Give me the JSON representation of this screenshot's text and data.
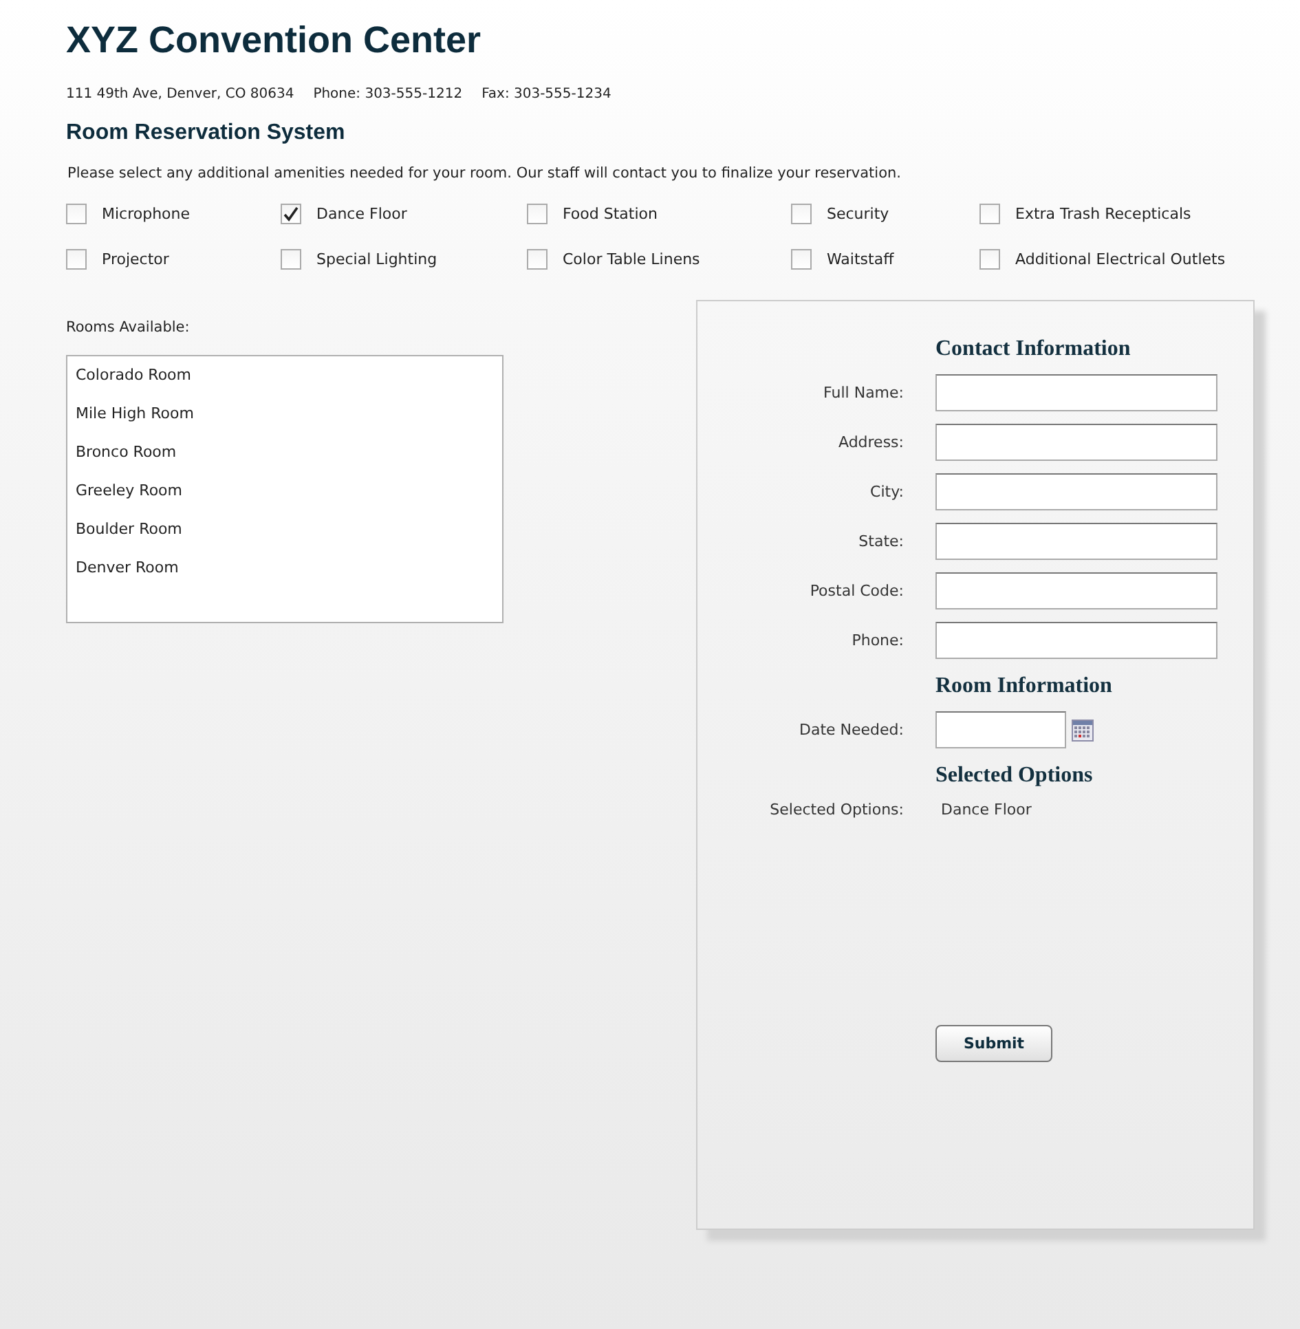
{
  "header": {
    "title": "XYZ Convention Center",
    "address": "111 49th Ave, Denver, CO 80634",
    "phone": "Phone: 303-555-1212",
    "fax": "Fax: 303-555-1234"
  },
  "subtitle": "Room Reservation System",
  "instructions": "Please select any additional amenities needed for your room. Our staff will contact you to finalize your reservation.",
  "amenities": [
    {
      "label": "Microphone",
      "checked": false
    },
    {
      "label": "Dance Floor",
      "checked": true
    },
    {
      "label": "Food Station",
      "checked": false
    },
    {
      "label": "Security",
      "checked": false
    },
    {
      "label": "Extra Trash Recepticals",
      "checked": false
    },
    {
      "label": "Projector",
      "checked": false
    },
    {
      "label": "Special Lighting",
      "checked": false
    },
    {
      "label": "Color Table Linens",
      "checked": false
    },
    {
      "label": "Waitstaff",
      "checked": false
    },
    {
      "label": "Additional Electrical Outlets",
      "checked": false
    }
  ],
  "rooms": {
    "label": "Rooms Available:",
    "items": [
      "Colorado Room",
      "Mile High Room",
      "Bronco Room",
      "Greeley Room",
      "Boulder Room",
      "Denver Room"
    ]
  },
  "form": {
    "sections": [
      {
        "heading": "Contact Information",
        "fields": [
          {
            "kind": "text",
            "label": "Full Name:"
          },
          {
            "kind": "text",
            "label": "Address:"
          },
          {
            "kind": "text",
            "label": "City:"
          },
          {
            "kind": "text",
            "label": "State:"
          },
          {
            "kind": "text",
            "label": "Postal Code:"
          },
          {
            "kind": "text",
            "label": "Phone:"
          }
        ]
      },
      {
        "heading": "Room Information",
        "fields": [
          {
            "kind": "date",
            "label": "Date Needed:"
          }
        ]
      },
      {
        "heading": "Selected Options",
        "fields": [
          {
            "kind": "value",
            "label": "Selected Options:",
            "value": "Dance Floor"
          }
        ]
      }
    ],
    "submit": "Submit"
  }
}
